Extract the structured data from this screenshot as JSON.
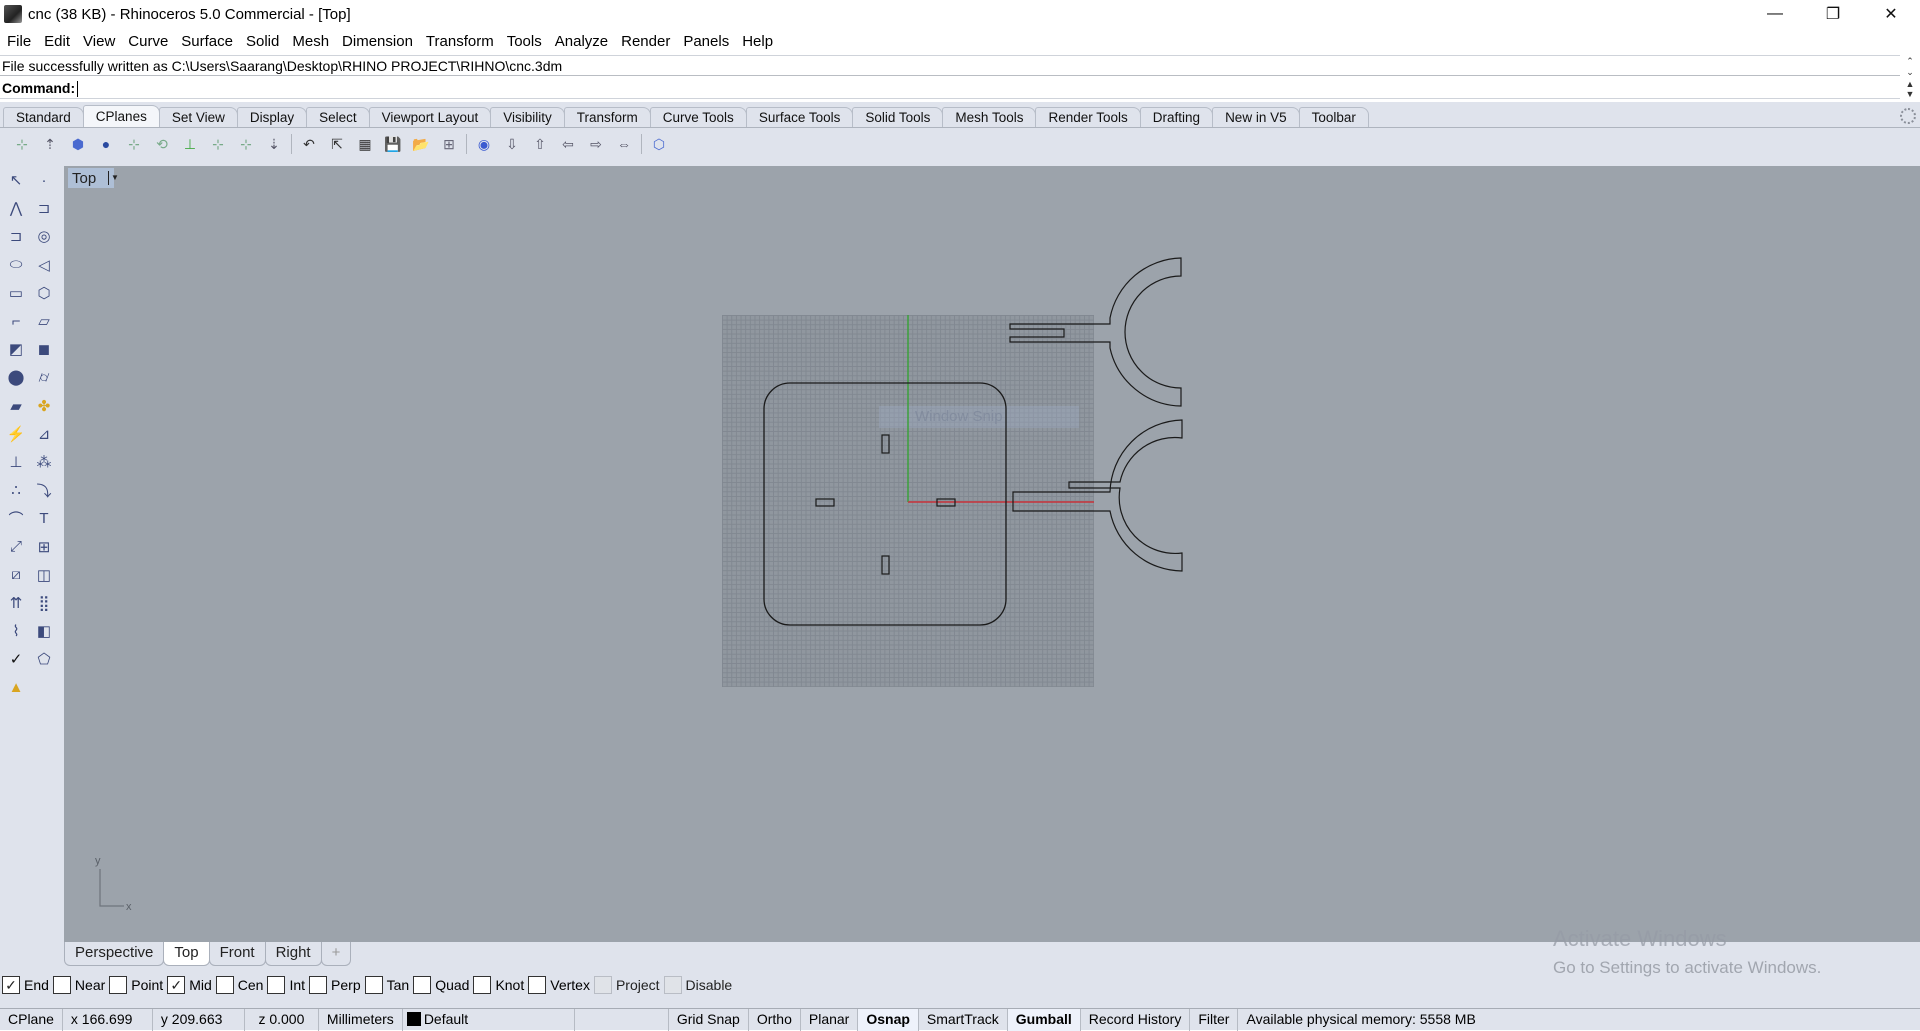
{
  "window": {
    "title": "cnc (38 KB) - Rhinoceros 5.0 Commercial - [Top]",
    "controls": {
      "minimize": "—",
      "restore": "❐",
      "close": "✕"
    }
  },
  "menu": [
    "File",
    "Edit",
    "View",
    "Curve",
    "Surface",
    "Solid",
    "Mesh",
    "Dimension",
    "Transform",
    "Tools",
    "Analyze",
    "Render",
    "Panels",
    "Help"
  ],
  "command_history": "File successfully written as C:\\Users\\Saarang\\Desktop\\RHINO PROJECT\\RIHNO\\cnc.3dm",
  "command": {
    "label": "Command:",
    "value": ""
  },
  "toolbar_tabs": [
    {
      "label": "Standard",
      "active": false
    },
    {
      "label": "CPlanes",
      "active": true
    },
    {
      "label": "Set View",
      "active": false
    },
    {
      "label": "Display",
      "active": false
    },
    {
      "label": "Select",
      "active": false
    },
    {
      "label": "Viewport Layout",
      "active": false
    },
    {
      "label": "Visibility",
      "active": false
    },
    {
      "label": "Transform",
      "active": false
    },
    {
      "label": "Curve Tools",
      "active": false
    },
    {
      "label": "Surface Tools",
      "active": false
    },
    {
      "label": "Solid Tools",
      "active": false
    },
    {
      "label": "Mesh Tools",
      "active": false
    },
    {
      "label": "Render Tools",
      "active": false
    },
    {
      "label": "Drafting",
      "active": false
    },
    {
      "label": "New in V5",
      "active": false
    },
    {
      "label": "Toolbar",
      "active": false
    }
  ],
  "cplane_tools": [
    "cplane-origin",
    "cplane-elevation",
    "cplane-to-object",
    "cplane-to-surface",
    "cplane-3-point",
    "cplane-rotate",
    "cplane-z-axis",
    "cplane-x-axis",
    "cplane-y-axis",
    "cplane-perpendicular",
    "undo-cplane",
    "cplane-to-view",
    "cplane-grid",
    "save-cplane",
    "open-cplane",
    "named-cplanes",
    "cplane-view-top",
    "cplane-top",
    "cplane-bottom",
    "cplane-left",
    "cplane-right",
    "cplane-front-back",
    "cplane-object"
  ],
  "left_tools": [
    [
      "select",
      "point"
    ],
    [
      "polyline",
      "curve-control-points"
    ],
    [
      "curve-interpolate",
      "circle"
    ],
    [
      "ellipse",
      "arc"
    ],
    [
      "rectangle",
      "polygon"
    ],
    [
      "fillet-curves",
      "surface-from-points"
    ],
    [
      "extrude-curve",
      "box"
    ],
    [
      "boolean-union",
      "cylinder"
    ],
    [
      "surface-edit",
      "join"
    ],
    [
      "explode",
      "trim"
    ],
    [
      "split",
      "group"
    ],
    [
      "ungroup",
      "offset-curve"
    ],
    [
      "fillet",
      "text"
    ],
    [
      "move",
      "array"
    ],
    [
      "scale",
      "solid-edit"
    ],
    [
      "extrude",
      "array-grid"
    ],
    [
      "bend",
      "mirror-solid"
    ],
    [
      "check",
      "analysis"
    ],
    [
      "render-shade"
    ]
  ],
  "viewport": {
    "name": "Top",
    "axis_labels": {
      "x": "x",
      "y": "y"
    },
    "ghost_text": "Window Snip"
  },
  "viewport_tabs": [
    {
      "label": "Perspective",
      "active": false
    },
    {
      "label": "Top",
      "active": true
    },
    {
      "label": "Front",
      "active": false
    },
    {
      "label": "Right",
      "active": false
    },
    {
      "label": "+",
      "active": false
    }
  ],
  "osnaps": [
    {
      "label": "End",
      "checked": true,
      "enabled": true
    },
    {
      "label": "Near",
      "checked": false,
      "enabled": true
    },
    {
      "label": "Point",
      "checked": false,
      "enabled": true
    },
    {
      "label": "Mid",
      "checked": true,
      "enabled": true
    },
    {
      "label": "Cen",
      "checked": false,
      "enabled": true
    },
    {
      "label": "Int",
      "checked": false,
      "enabled": true
    },
    {
      "label": "Perp",
      "checked": false,
      "enabled": true
    },
    {
      "label": "Tan",
      "checked": false,
      "enabled": true
    },
    {
      "label": "Quad",
      "checked": false,
      "enabled": true
    },
    {
      "label": "Knot",
      "checked": false,
      "enabled": true
    },
    {
      "label": "Vertex",
      "checked": false,
      "enabled": true
    },
    {
      "label": "Project",
      "checked": false,
      "enabled": false
    },
    {
      "label": "Disable",
      "checked": false,
      "enabled": false
    }
  ],
  "status": {
    "cplane": "CPlane",
    "x": "x 166.699",
    "y": "y 209.663",
    "z": "z 0.000",
    "units": "Millimeters",
    "layer": "Default",
    "layer_color": "#000000",
    "toggles": [
      {
        "label": "Grid Snap",
        "on": false
      },
      {
        "label": "Ortho",
        "on": false
      },
      {
        "label": "Planar",
        "on": false
      },
      {
        "label": "Osnap",
        "on": true
      },
      {
        "label": "SmartTrack",
        "on": false
      },
      {
        "label": "Gumball",
        "on": true
      },
      {
        "label": "Record History",
        "on": false
      },
      {
        "label": "Filter",
        "on": false
      }
    ],
    "memory": "Available physical memory: 5558 MB"
  },
  "watermark": {
    "line1": "Activate Windows",
    "line2": "Go to Settings to activate Windows."
  },
  "colors": {
    "viewport_bg": "#9ca3ab",
    "x_axis": "#c8323a",
    "y_axis": "#3ca03c",
    "ui_bg": "#dfe3ec"
  }
}
